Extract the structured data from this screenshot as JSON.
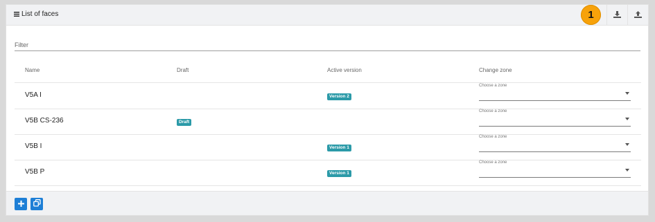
{
  "header": {
    "title": "List of faces",
    "step_badge": "1",
    "icons": [
      "list-icon",
      "download-icon",
      "upload-icon"
    ]
  },
  "filter": {
    "placeholder": "Filter",
    "value": ""
  },
  "table": {
    "columns": [
      "Name",
      "Draft",
      "Active version",
      "Change zone"
    ],
    "rows": [
      {
        "name": "V5A I",
        "draft": "",
        "version": "Version 2",
        "zone_placeholder": "Choose a zone"
      },
      {
        "name": "V5B CS-236",
        "draft": "Draft",
        "version": "",
        "zone_placeholder": "Choose a zone"
      },
      {
        "name": "V5B I",
        "draft": "",
        "version": "Version 1",
        "zone_placeholder": "Choose a zone"
      },
      {
        "name": "V5B P",
        "draft": "",
        "version": "Version 1",
        "zone_placeholder": "Choose a zone"
      }
    ]
  },
  "footer": {
    "buttons": [
      "add-icon",
      "duplicate-icon"
    ]
  },
  "colors": {
    "badge": "#f7a20a",
    "tag": "#2b9aa8",
    "button": "#1e7fd6"
  }
}
